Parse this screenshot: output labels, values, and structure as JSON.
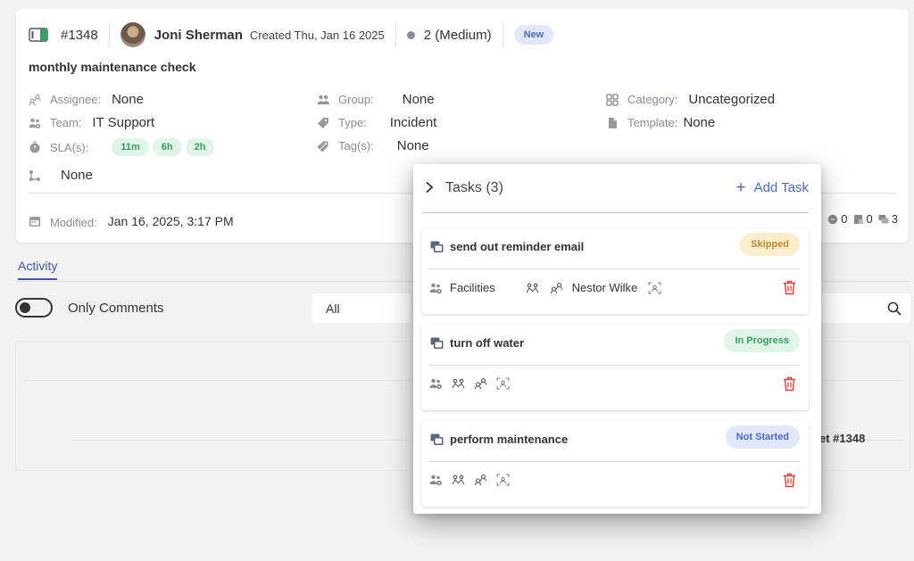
{
  "ticket": {
    "id": "#1348",
    "author": "Joni Sherman",
    "created": "Created Thu, Jan 16 2025",
    "priority": "2 (Medium)",
    "status_badge": "New",
    "title": "monthly maintenance check"
  },
  "fields": {
    "assignee_label": "Assignee:",
    "assignee_value": "None",
    "team_label": "Team:",
    "team_value": "IT Support",
    "sla_label": "SLA(s):",
    "sla_pills": [
      "11m",
      "6h",
      "2h"
    ],
    "workflow_value": "None",
    "group_label": "Group:",
    "group_value": "None",
    "type_label": "Type:",
    "type_value": "Incident",
    "tags_label": "Tag(s):",
    "tags_value": "None",
    "category_label": "Category:",
    "category_value": "Uncategorized",
    "template_label": "Template:",
    "template_value": "None",
    "modified_label": "Modified:",
    "modified_value": "Jan 16, 2025, 3:17 PM"
  },
  "counts": {
    "a": "0",
    "b": "0",
    "c": "3"
  },
  "activity": {
    "tab": "Activity",
    "only_comments": "Only Comments",
    "filter_value": "All",
    "feed_ref": "et #1348"
  },
  "tasks_popup": {
    "title": "Tasks (3)",
    "add_label": "Add Task",
    "tasks": [
      {
        "name": "send out reminder email",
        "status": "Skipped",
        "group": "Facilities",
        "assignee": "Nestor Wilke"
      },
      {
        "name": "turn off water",
        "status": "In Progress",
        "group": "",
        "assignee": ""
      },
      {
        "name": "perform maintenance",
        "status": "Not Started",
        "group": "",
        "assignee": ""
      }
    ]
  },
  "colors": {
    "accent": "#4a6bc4",
    "delete": "#e0413a",
    "success": "#3a9e62",
    "warning": "#c08a2a"
  }
}
